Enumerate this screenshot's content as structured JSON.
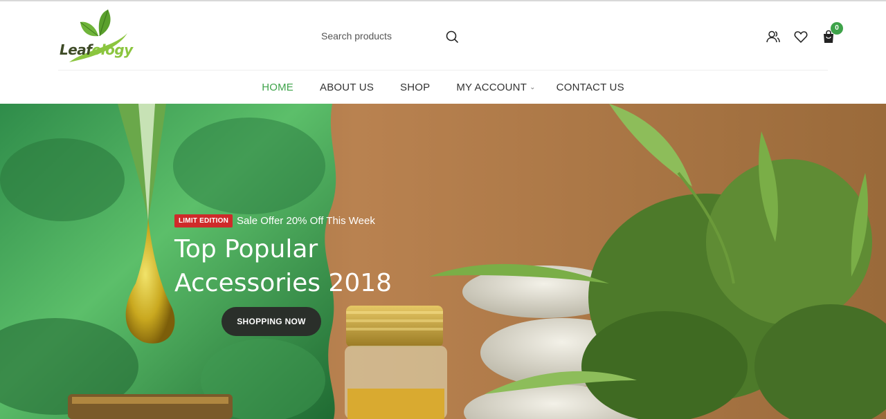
{
  "brand": {
    "name_part1": "Leaf",
    "name_part2": "ology"
  },
  "search": {
    "placeholder": "Search products"
  },
  "header_icons": {
    "account": "user-icon",
    "wishlist": "heart-icon",
    "cart": "shopping-bag-icon",
    "cart_count": "0"
  },
  "nav": {
    "items": [
      {
        "label": "HOME",
        "active": true
      },
      {
        "label": "ABOUT US"
      },
      {
        "label": "SHOP"
      },
      {
        "label": "MY ACCOUNT",
        "has_dropdown": true
      },
      {
        "label": "CONTACT US"
      }
    ]
  },
  "hero": {
    "badge": "LIMIT EDITION",
    "promo": "Sale Offer 20% Off This Week",
    "title_line1": "Top Popular",
    "title_line2": "Accessories 2018",
    "cta": "SHOPPING NOW"
  },
  "colors": {
    "accent": "#3ea34a",
    "badge_red": "#cf2a2a",
    "cta_bg": "#2a2f2a"
  }
}
